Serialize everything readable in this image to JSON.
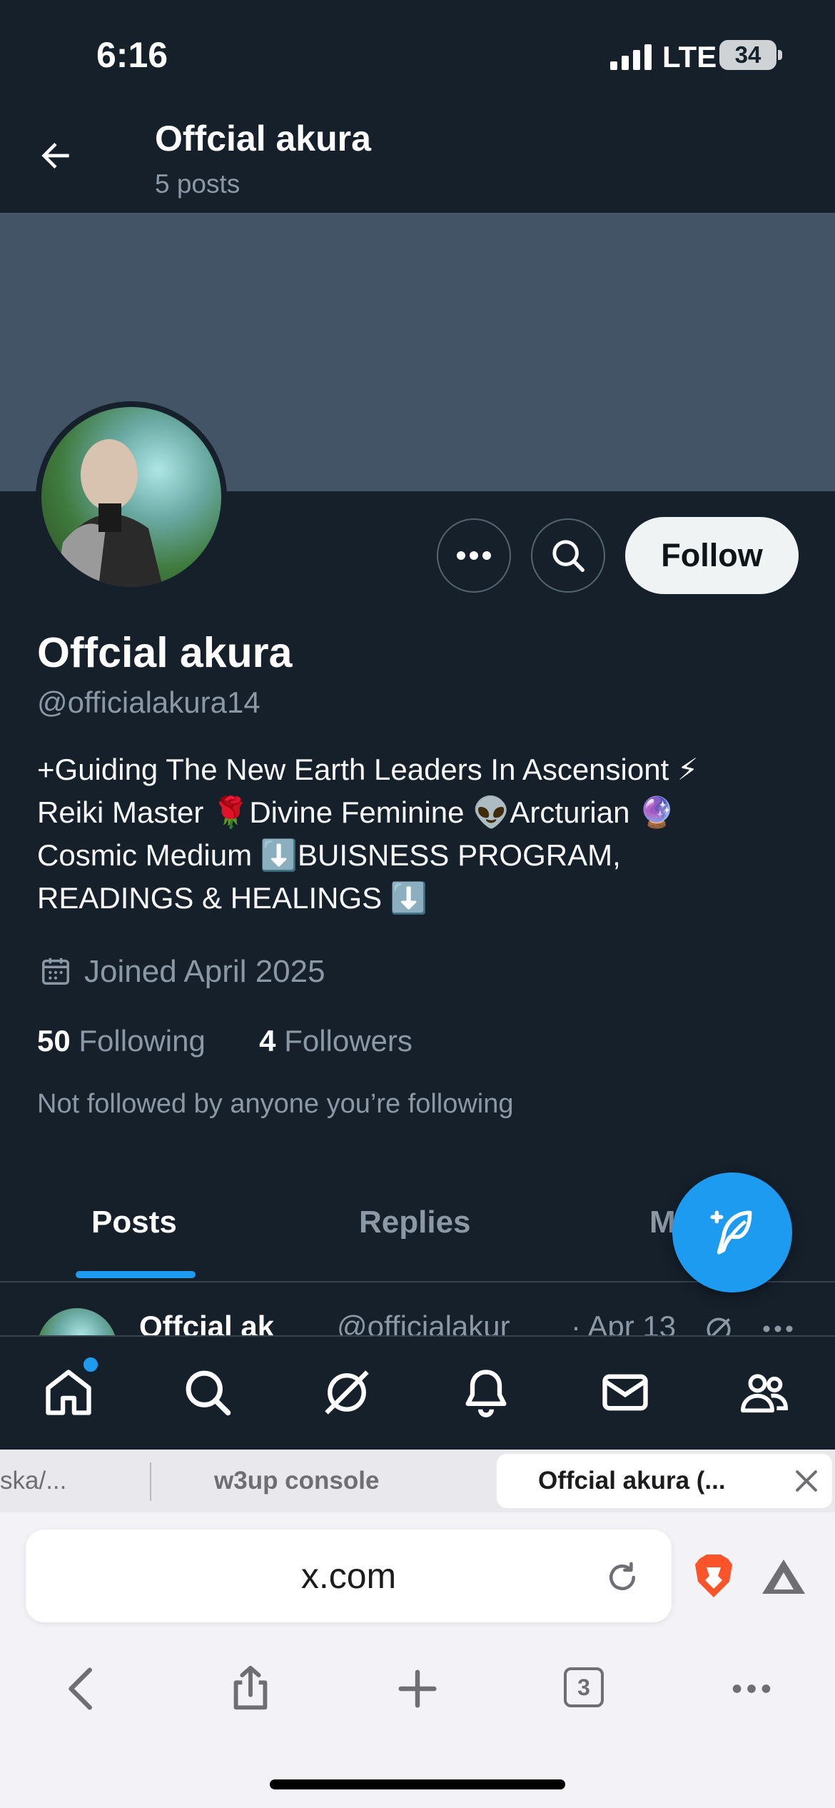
{
  "status_bar": {
    "time": "6:16",
    "network": "LTE",
    "battery": "34"
  },
  "header": {
    "title": "Offcial akura",
    "subtitle": "5 posts"
  },
  "profile": {
    "name": "Offcial akura",
    "handle": "@officialakura14",
    "bio_lines": [
      "+Guiding The New Earth Leaders In Ascensiont ⚡",
      "Reiki Master 🌹Divine Feminine 👽Arcturian 🔮",
      "Cosmic Medium ⬇️BUISNESS PROGRAM,",
      "READINGS & HEALINGS ⬇️"
    ],
    "joined": "Joined April 2025",
    "following_count": "50",
    "following_label": "Following",
    "followers_count": "4",
    "followers_label": "Followers",
    "not_followed": "Not followed by anyone you’re following",
    "follow_label": "Follow"
  },
  "tabs": {
    "posts": "Posts",
    "replies": "Replies",
    "more": "M"
  },
  "peek_post": {
    "name": "Offcial ak",
    "handle": "@officialakur",
    "date": "· Apr 13"
  },
  "browser": {
    "tabs": [
      "ska/...",
      "w3up console",
      "Offcial akura (..."
    ],
    "url": "x.com",
    "tab_count": "3"
  },
  "colors": {
    "accent": "#1d9bf0",
    "background": "#15202b",
    "banner": "#425466"
  }
}
